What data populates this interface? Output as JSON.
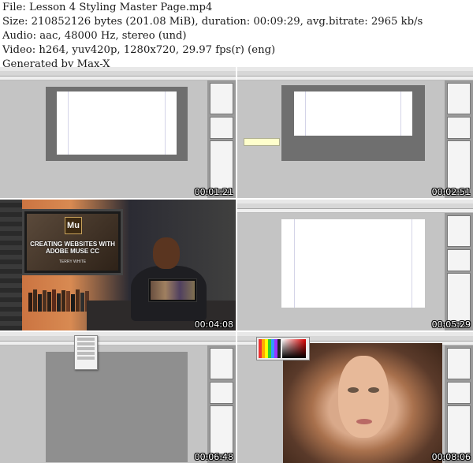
{
  "header": {
    "file_line": "File: Lesson 4 Styling Master Page.mp4",
    "size_line": "Size: 210852126 bytes (201.08 MiB), duration: 00:09:29, avg.bitrate: 2965 kb/s",
    "audio_line": "Audio: aac, 48000 Hz, stereo (und)",
    "video_line": "Video: h264, yuv420p, 1280x720, 29.97 fps(r) (eng)",
    "generator_line": "Generated by Max-X"
  },
  "thumbnails": [
    {
      "timestamp": "00:01:21",
      "scene": "muse-editor-blank-page"
    },
    {
      "timestamp": "00:02:51",
      "scene": "muse-editor-page-with-tooltip"
    },
    {
      "timestamp": "00:04:08",
      "scene": "presenter-video",
      "tv_logo": "Mu",
      "tv_title": "CREATING WEBSITES WITH ADOBE MUSE CC",
      "tv_subtitle": "TERRY WHITE"
    },
    {
      "timestamp": "00:05:29",
      "scene": "muse-editor-white-page"
    },
    {
      "timestamp": "00:06:48",
      "scene": "muse-editor-dropdown-menu"
    },
    {
      "timestamp": "00:08:06",
      "scene": "muse-editor-photo-color-picker"
    }
  ],
  "colors": {
    "background": "#ffffff",
    "header_text": "#1a1a1a",
    "timestamp_text": "#ffffff",
    "canvas_gray": "#c4c4c4",
    "panel_gray": "#9a9a9a"
  }
}
